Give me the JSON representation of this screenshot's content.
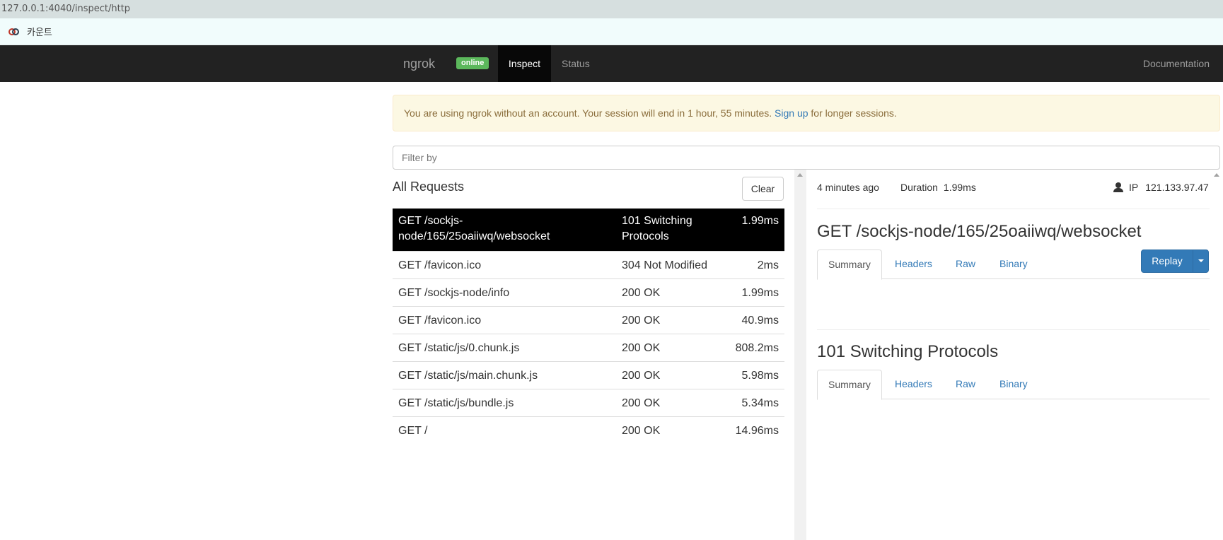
{
  "browser": {
    "url": "127.0.0.1:4040/inspect/http",
    "bookmark_label": "카운트"
  },
  "navbar": {
    "brand": "ngrok",
    "badge": "online",
    "tabs": {
      "inspect": "Inspect",
      "status": "Status"
    },
    "documentation": "Documentation"
  },
  "alert": {
    "before": "You are using ngrok without an account. Your session will end in 1 hour, 55 minutes. ",
    "link": "Sign up",
    "after": " for longer sessions."
  },
  "filter": {
    "placeholder": "Filter by",
    "value": ""
  },
  "requests": {
    "title": "All Requests",
    "clear_label": "Clear",
    "rows": [
      {
        "path": "GET /sockjs-node/165/25oaiiwq/websocket",
        "status": "101 Switching Protocols",
        "duration": "1.99ms"
      },
      {
        "path": "GET /favicon.ico",
        "status": "304 Not Modified",
        "duration": "2ms"
      },
      {
        "path": "GET /sockjs-node/info",
        "status": "200 OK",
        "duration": "1.99ms"
      },
      {
        "path": "GET /favicon.ico",
        "status": "200 OK",
        "duration": "40.9ms"
      },
      {
        "path": "GET /static/js/0.chunk.js",
        "status": "200 OK",
        "duration": "808.2ms"
      },
      {
        "path": "GET /static/js/main.chunk.js",
        "status": "200 OK",
        "duration": "5.98ms"
      },
      {
        "path": "GET /static/js/bundle.js",
        "status": "200 OK",
        "duration": "5.34ms"
      },
      {
        "path": "GET /",
        "status": "200 OK",
        "duration": "14.96ms"
      }
    ]
  },
  "detail": {
    "time_ago": "4 minutes ago",
    "duration_label": "Duration",
    "duration_value": "1.99ms",
    "ip_label": "IP",
    "ip_value": "121.133.97.47",
    "request_title": "GET /sockjs-node/165/25oaiiwq/websocket",
    "response_title": "101 Switching Protocols",
    "tabs": {
      "summary": "Summary",
      "headers": "Headers",
      "raw": "Raw",
      "binary": "Binary"
    },
    "replay_label": "Replay"
  },
  "colors": {
    "navbar": "#222222",
    "badge_online": "#5cb85c",
    "link": "#337ab7",
    "selected_row": "#000000",
    "alert_bg": "#fcf8e3"
  }
}
